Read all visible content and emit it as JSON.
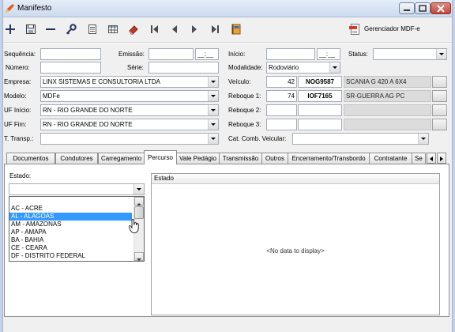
{
  "window": {
    "title": "Manifesto",
    "icon": "app-icon",
    "controls": [
      "minimize-icon",
      "maximize-icon",
      "close-icon"
    ]
  },
  "toolbar": {
    "icons": [
      "plus-icon",
      "save-icon",
      "minus-icon",
      "key-icon",
      "list-icon",
      "table-icon",
      "eraser-icon",
      "first-record-icon",
      "previous-record-icon",
      "next-record-icon",
      "last-record-icon",
      "notebook-icon"
    ],
    "manager": {
      "icon": "mdfe-icon",
      "label": "Gerenciador MDF-e"
    }
  },
  "form": {
    "sequencia": {
      "label": "Sequência:",
      "value": ""
    },
    "numero": {
      "label": "Número:",
      "value": ""
    },
    "emissao": {
      "label": "Emissão:",
      "date": "",
      "time": "__:__"
    },
    "serie": {
      "label": "Série:",
      "value": ""
    },
    "empresa": {
      "label": "Empresa:",
      "value": "LINX SISTEMAS E CONSULTORIA LTDA"
    },
    "modelo": {
      "label": "Modelo:",
      "value": "MDFe"
    },
    "uf_inicio": {
      "label": "UF Início:",
      "value": "RN - RIO GRANDE DO NORTE"
    },
    "uf_fim": {
      "label": "UF Fim:",
      "value": "RN - RIO GRANDE DO NORTE"
    },
    "t_transp": {
      "label": "T. Transp.:",
      "value": ""
    },
    "inicio": {
      "label": "Início:",
      "date": "",
      "time": "__:__"
    },
    "status": {
      "label": "Status:",
      "value": ""
    },
    "modalidade": {
      "label": "Modalidade:",
      "value": "Rodoviário"
    },
    "veiculo": {
      "label": "Veículo:",
      "code": "42",
      "plate": "NOG9587",
      "description": "SCANIA G 420 A 6X4"
    },
    "reboque1": {
      "label": "Reboque 1:",
      "code": "74",
      "plate": "IOF7165",
      "description": "SR-GUERRA AG PC"
    },
    "reboque2": {
      "label": "Reboque 2:",
      "code": "",
      "plate": "",
      "description": ""
    },
    "reboque3": {
      "label": "Reboque 3:",
      "code": "",
      "plate": "",
      "description": ""
    },
    "cat_comb": {
      "label": "Cat. Comb. Veicular:",
      "value": ""
    }
  },
  "tabs": {
    "items": [
      "Documentos",
      "Condutores",
      "Carregamento",
      "Percurso",
      "Vale Pedágio",
      "Transmissão",
      "Outros",
      "Encerramento/Transbordo",
      "Contratante",
      "Se"
    ],
    "active_index": 3
  },
  "percurso": {
    "estado_label": "Estado:",
    "estado_value": "",
    "options": [
      "",
      "AC - ACRE",
      "AL - ALAGOAS",
      "AM - AMAZONAS",
      "AP - AMAPA",
      "BA - BAHIA",
      "CE - CEARA",
      "DF - DISTRITO FEDERAL"
    ],
    "highlighted_index": 2,
    "grid": {
      "header": "Estado",
      "empty_text": "<No data to display>"
    }
  },
  "colors": {
    "selection": "#3399ff",
    "close_button": "#c4463a",
    "readonly_field": "#dcdcdc",
    "title_bar": "#d6e2f1"
  }
}
